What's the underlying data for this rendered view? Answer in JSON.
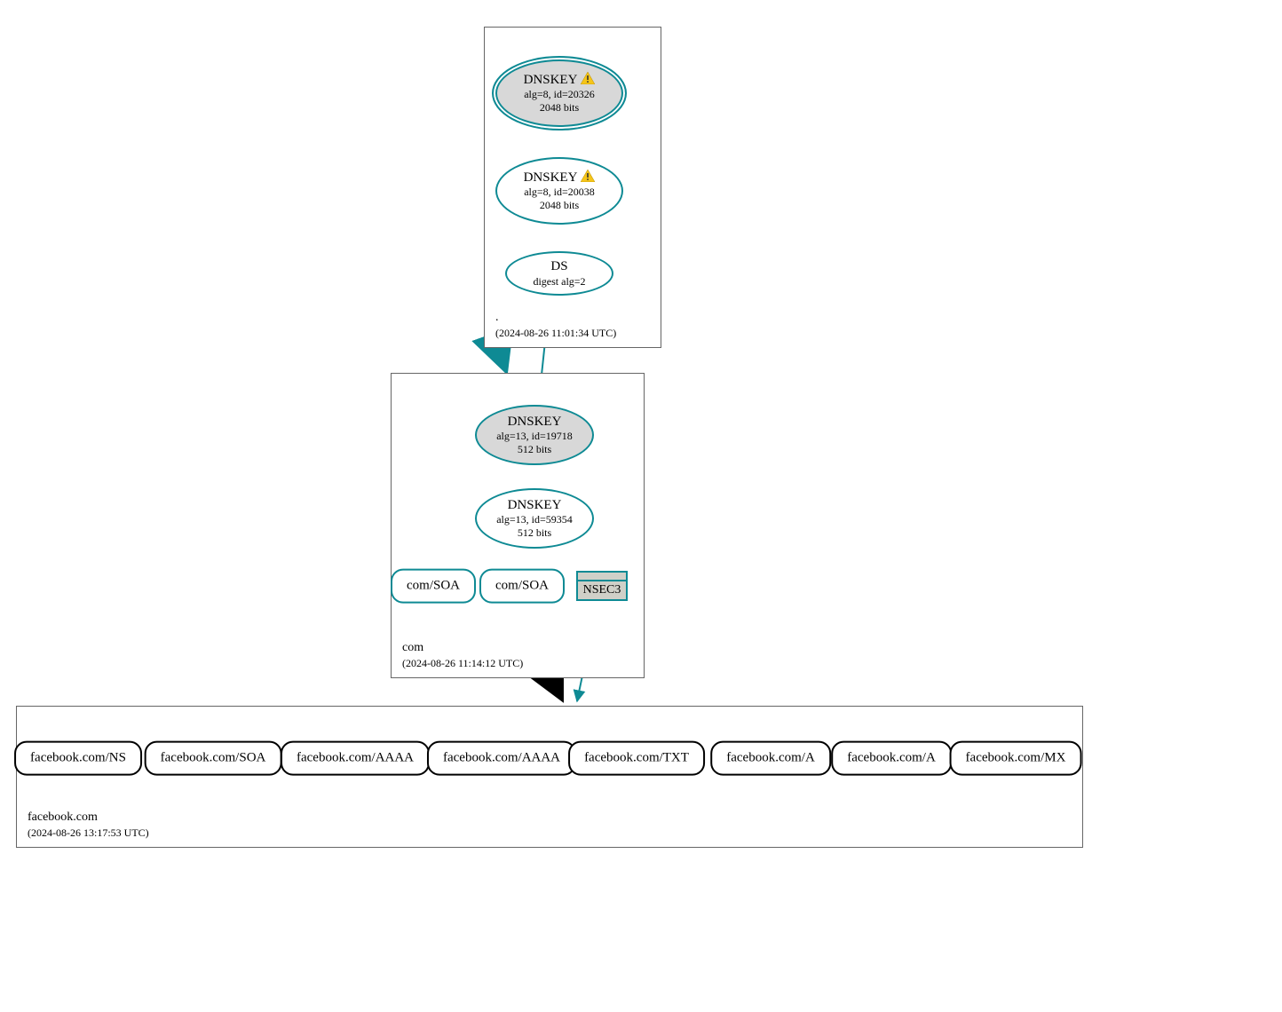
{
  "zones": {
    "root": {
      "name": ".",
      "timestamp": "(2024-08-26 11:01:34 UTC)",
      "nodes": {
        "ksk": {
          "title": "DNNSKEY",
          "title_real": "DNSKEY",
          "sub1": "alg=8, id=20326",
          "sub2": "2048 bits",
          "warn": true
        },
        "zsk": {
          "title": "DNSKEY",
          "sub1": "alg=8, id=20038",
          "sub2": "2048 bits",
          "warn": true
        },
        "ds": {
          "title": "DS",
          "sub1": "digest alg=2"
        }
      }
    },
    "com": {
      "name": "com",
      "timestamp": "(2024-08-26 11:14:12 UTC)",
      "nodes": {
        "ksk": {
          "title": "DNSKEY",
          "sub1": "alg=13, id=19718",
          "sub2": "512 bits"
        },
        "zsk": {
          "title": "DNSKEY",
          "sub1": "alg=13, id=59354",
          "sub2": "512 bits"
        },
        "soa1": {
          "label": "com/SOA"
        },
        "soa2": {
          "label": "com/SOA"
        },
        "nsec3": {
          "label": "NSEC3"
        }
      }
    },
    "facebook": {
      "name": "facebook.com",
      "timestamp": "(2024-08-26 13:17:53 UTC)",
      "records": [
        "facebook.com/NS",
        "facebook.com/SOA",
        "facebook.com/AAAA",
        "facebook.com/AAAA",
        "facebook.com/TXT",
        "facebook.com/A",
        "facebook.com/A",
        "facebook.com/MX"
      ]
    }
  }
}
